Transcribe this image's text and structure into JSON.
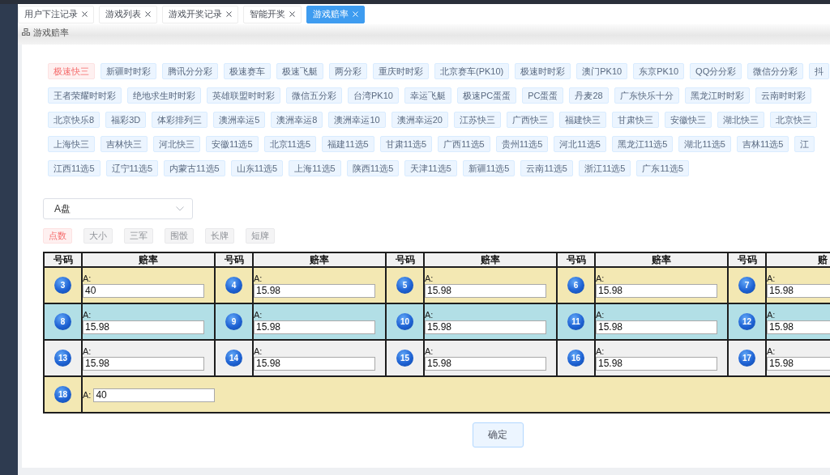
{
  "tabs": [
    {
      "label": "用户下注记录",
      "selected": false
    },
    {
      "label": "游戏列表",
      "selected": false
    },
    {
      "label": "游戏开奖记录",
      "selected": false
    },
    {
      "label": "智能开奖",
      "selected": false
    },
    {
      "label": "游戏赔率",
      "selected": true
    }
  ],
  "breadcrumb": {
    "title": "游戏赔率"
  },
  "game_tag_rows": [
    {
      "tags": [
        {
          "label": "极速快三",
          "selected": true
        },
        {
          "label": "新疆时时彩",
          "selected": false
        },
        {
          "label": "腾讯分分彩",
          "selected": false
        },
        {
          "label": "极速赛车",
          "selected": false
        },
        {
          "label": "极速飞艇",
          "selected": false
        },
        {
          "label": "两分彩",
          "selected": false
        },
        {
          "label": "重庆时时彩",
          "selected": false
        },
        {
          "label": "北京赛车(PK10)",
          "selected": false
        },
        {
          "label": "极速时时彩",
          "selected": false
        },
        {
          "label": "澳门PK10",
          "selected": false
        },
        {
          "label": "东京PK10",
          "selected": false
        },
        {
          "label": "QQ分分彩",
          "selected": false
        },
        {
          "label": "微信分分彩",
          "selected": false
        },
        {
          "label": "抖",
          "selected": false
        }
      ]
    },
    {
      "tags": [
        {
          "label": "王者荣耀时时彩",
          "selected": false
        },
        {
          "label": "绝地求生时时彩",
          "selected": false
        },
        {
          "label": "英雄联盟时时彩",
          "selected": false
        },
        {
          "label": "微信五分彩",
          "selected": false
        },
        {
          "label": "台湾PK10",
          "selected": false
        },
        {
          "label": "幸运飞艇",
          "selected": false
        },
        {
          "label": "极速PC蛋蛋",
          "selected": false
        },
        {
          "label": "PC蛋蛋",
          "selected": false
        },
        {
          "label": "丹麦28",
          "selected": false
        },
        {
          "label": "广东快乐十分",
          "selected": false
        },
        {
          "label": "黑龙江时时彩",
          "selected": false
        },
        {
          "label": "云南时时彩",
          "selected": false
        }
      ]
    },
    {
      "tags": [
        {
          "label": "北京快乐8",
          "selected": false
        },
        {
          "label": "福彩3D",
          "selected": false
        },
        {
          "label": "体彩排列三",
          "selected": false
        },
        {
          "label": "澳洲幸运5",
          "selected": false
        },
        {
          "label": "澳洲幸运8",
          "selected": false
        },
        {
          "label": "澳洲幸运10",
          "selected": false
        },
        {
          "label": "澳洲幸运20",
          "selected": false
        },
        {
          "label": "江苏快三",
          "selected": false
        },
        {
          "label": "广西快三",
          "selected": false
        },
        {
          "label": "福建快三",
          "selected": false
        },
        {
          "label": "甘肃快三",
          "selected": false
        },
        {
          "label": "安徽快三",
          "selected": false
        },
        {
          "label": "湖北快三",
          "selected": false
        },
        {
          "label": "北京快三",
          "selected": false
        }
      ]
    },
    {
      "tags": [
        {
          "label": "上海快三",
          "selected": false
        },
        {
          "label": "吉林快三",
          "selected": false
        },
        {
          "label": "河北快三",
          "selected": false
        },
        {
          "label": "安徽11选5",
          "selected": false
        },
        {
          "label": "北京11选5",
          "selected": false
        },
        {
          "label": "福建11选5",
          "selected": false
        },
        {
          "label": "甘肃11选5",
          "selected": false
        },
        {
          "label": "广西11选5",
          "selected": false
        },
        {
          "label": "贵州11选5",
          "selected": false
        },
        {
          "label": "河北11选5",
          "selected": false
        },
        {
          "label": "黑龙江11选5",
          "selected": false
        },
        {
          "label": "湖北11选5",
          "selected": false
        },
        {
          "label": "吉林11选5",
          "selected": false
        },
        {
          "label": "江",
          "selected": false
        }
      ]
    },
    {
      "tags": [
        {
          "label": "江西11选5",
          "selected": false
        },
        {
          "label": "辽宁11选5",
          "selected": false
        },
        {
          "label": "内蒙古11选5",
          "selected": false
        },
        {
          "label": "山东11选5",
          "selected": false
        },
        {
          "label": "上海11选5",
          "selected": false
        },
        {
          "label": "陕西11选5",
          "selected": false
        },
        {
          "label": "天津11选5",
          "selected": false
        },
        {
          "label": "新疆11选5",
          "selected": false
        },
        {
          "label": "云南11选5",
          "selected": false
        },
        {
          "label": "浙江11选5",
          "selected": false
        },
        {
          "label": "广东11选5",
          "selected": false
        }
      ]
    }
  ],
  "market_select": {
    "value": "A盘"
  },
  "bet_types": [
    {
      "label": "点数",
      "selected": true
    },
    {
      "label": "大小",
      "selected": false
    },
    {
      "label": "三军",
      "selected": false
    },
    {
      "label": "围骰",
      "selected": false
    },
    {
      "label": "长牌",
      "selected": false
    },
    {
      "label": "短牌",
      "selected": false
    }
  ],
  "odds_table": {
    "columns": [
      "号码",
      "赔率",
      "号码",
      "赔率",
      "号码",
      "赔率",
      "号码",
      "赔率",
      "号码",
      "赔"
    ],
    "rows": [
      {
        "color": "#f3e8b3",
        "cells": [
          {
            "kind": "number",
            "text": "3"
          },
          {
            "kind": "odds",
            "label": "A:",
            "value": "40"
          },
          {
            "kind": "number",
            "text": "4"
          },
          {
            "kind": "odds",
            "label": "A:",
            "value": "15.98"
          },
          {
            "kind": "number",
            "text": "5"
          },
          {
            "kind": "odds",
            "label": "A:",
            "value": "15.98"
          },
          {
            "kind": "number",
            "text": "6"
          },
          {
            "kind": "odds",
            "label": "A:",
            "value": "15.98"
          },
          {
            "kind": "number",
            "text": "7"
          },
          {
            "kind": "odds",
            "label": "A:",
            "value": "15.98"
          }
        ]
      },
      {
        "color": "#b2dfe6",
        "cells": [
          {
            "kind": "number",
            "text": "8"
          },
          {
            "kind": "odds",
            "label": "A:",
            "value": "15.98"
          },
          {
            "kind": "number",
            "text": "9"
          },
          {
            "kind": "odds",
            "label": "A:",
            "value": "15.98"
          },
          {
            "kind": "number",
            "text": "10"
          },
          {
            "kind": "odds",
            "label": "A:",
            "value": "15.98"
          },
          {
            "kind": "number",
            "text": "11"
          },
          {
            "kind": "odds",
            "label": "A:",
            "value": "15.98"
          },
          {
            "kind": "number",
            "text": "12"
          },
          {
            "kind": "odds",
            "label": "A:",
            "value": "15.98"
          }
        ]
      },
      {
        "color": "#f0f0f0",
        "cells": [
          {
            "kind": "number",
            "text": "13"
          },
          {
            "kind": "odds",
            "label": "A:",
            "value": "15.98"
          },
          {
            "kind": "number",
            "text": "14"
          },
          {
            "kind": "odds",
            "label": "A:",
            "value": "15.98"
          },
          {
            "kind": "number",
            "text": "15"
          },
          {
            "kind": "odds",
            "label": "A:",
            "value": "15.98"
          },
          {
            "kind": "number",
            "text": "16"
          },
          {
            "kind": "odds",
            "label": "A:",
            "value": "15.98"
          },
          {
            "kind": "number",
            "text": "17"
          },
          {
            "kind": "odds",
            "label": "A:",
            "value": "15.98"
          }
        ]
      },
      {
        "color": "#f3e8b3",
        "cells": [
          {
            "kind": "number",
            "text": "18"
          },
          {
            "kind": "odds_inline",
            "label": "A:",
            "value": "40",
            "colspan": 9
          }
        ]
      }
    ]
  },
  "confirm_button": {
    "label": "确定"
  }
}
